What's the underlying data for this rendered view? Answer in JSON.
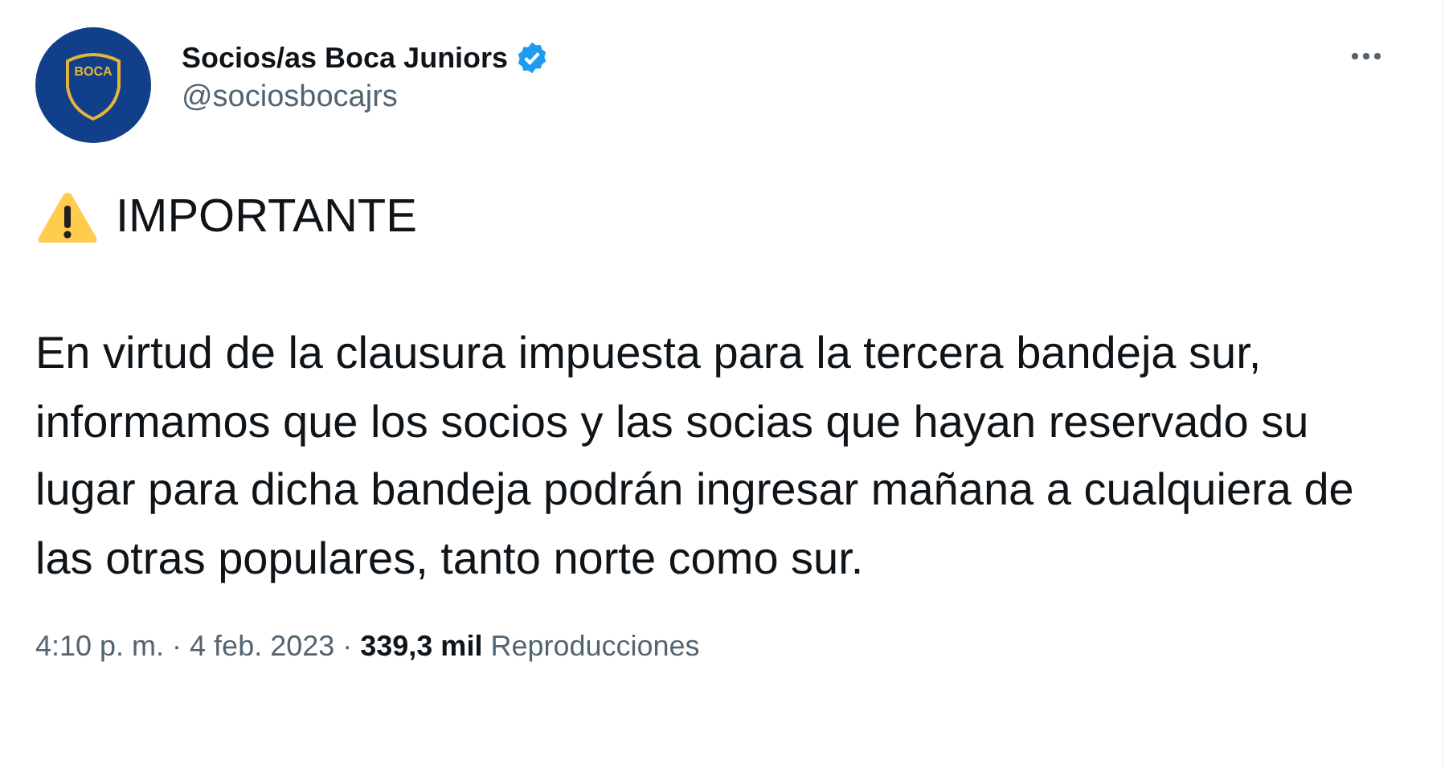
{
  "author": {
    "name": "Socios/as Boca Juniors",
    "handle": "@sociosbocajrs",
    "verified": true,
    "logo_text": "BOCA"
  },
  "tweet": {
    "headline": "IMPORTANTE",
    "body": "En virtud de la clausura impuesta para la tercera bandeja sur, informamos que los socios y las socias que hayan reservado su lugar para dicha bandeja podrán ingresar mañana a cualquiera de las otras populares, tanto norte como sur."
  },
  "meta": {
    "time": "4:10 p. m.",
    "separator": "·",
    "date": "4 feb. 2023",
    "views_count": "339,3 mil",
    "views_label": "Reproducciones"
  }
}
